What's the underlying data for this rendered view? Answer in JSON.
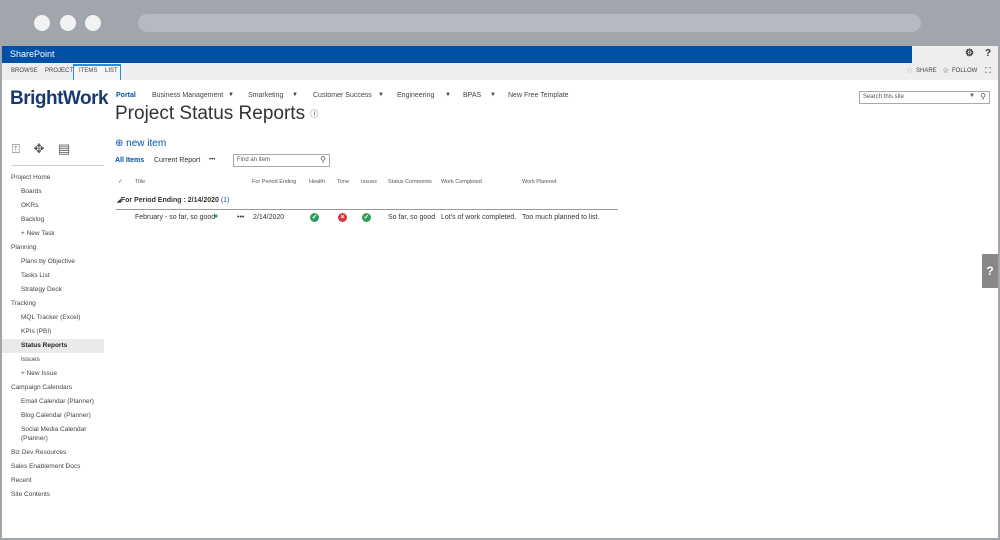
{
  "suite": {
    "brand": "SharePoint",
    "settings_icon": "gear-icon",
    "help_icon": "question-icon"
  },
  "ribbon": {
    "tabs": [
      "BROWSE",
      "PROJECT",
      "ITEMS",
      "LIST"
    ],
    "share": "SHARE",
    "follow": "FOLLOW"
  },
  "logo": "BrightWork",
  "topnav": [
    "Portal",
    "Business Management",
    "Smarketing",
    "Customer Success",
    "Engineering",
    "BPAS",
    "New Free Template"
  ],
  "search": {
    "placeholder": "Search this site"
  },
  "page_title": "Project Status Reports",
  "sidebar": {
    "items": [
      {
        "label": "Project Home",
        "level": 0
      },
      {
        "label": "Boards",
        "level": 1
      },
      {
        "label": "OKRs",
        "level": 1
      },
      {
        "label": "Backlog",
        "level": 1
      },
      {
        "label": "+ New Task",
        "level": 1
      },
      {
        "label": "Planning",
        "level": 0
      },
      {
        "label": "Plans by Objective",
        "level": 1
      },
      {
        "label": "Tasks List",
        "level": 1
      },
      {
        "label": "Strategy Deck",
        "level": 1
      },
      {
        "label": "Tracking",
        "level": 0
      },
      {
        "label": "MQL Tracker (Excel)",
        "level": 1
      },
      {
        "label": "KPIs (PBI)",
        "level": 1
      },
      {
        "label": "Status Reports",
        "level": 1,
        "selected": true
      },
      {
        "label": "Issues",
        "level": 1
      },
      {
        "label": "+ New Issue",
        "level": 1
      },
      {
        "label": "Campaign Calendars",
        "level": 0
      },
      {
        "label": "Email Calendar (Planner)",
        "level": 1
      },
      {
        "label": "Blog Calendar (Planner)",
        "level": 1
      },
      {
        "label": "Social Media Calendar",
        "level": 1
      },
      {
        "label": "(Planner)",
        "level": 1
      },
      {
        "label": "Biz Dev Resources",
        "level": 0
      },
      {
        "label": "Sales Enablement Docs",
        "level": 0
      },
      {
        "label": "Recent",
        "level": 0
      },
      {
        "label": "Site Contents",
        "level": 0
      }
    ]
  },
  "list": {
    "new_item": "new item",
    "views": [
      "All Items",
      "Current Report",
      "•••"
    ],
    "find_placeholder": "Find an item",
    "columns": [
      "✓",
      "Title",
      "For Period Ending",
      "Health",
      "Time",
      "Issues",
      "Status Comments",
      "Work Completed",
      "Work Planned"
    ],
    "group_label": "For Period Ending : 2/14/2020",
    "group_count": "(1)",
    "rows": [
      {
        "title": "February - so far, so good",
        "menu": "•••",
        "period": "2/14/2020",
        "health": "ok",
        "time": "error",
        "issues": "ok",
        "comments": "So far, so good",
        "completed": "Lot's of work completed.",
        "planned": "Too much planned to list."
      }
    ]
  },
  "colors": {
    "suite_blue": "#0050a8",
    "ok": "#2e9e5b",
    "error": "#d9363e"
  },
  "help_tab": "?"
}
